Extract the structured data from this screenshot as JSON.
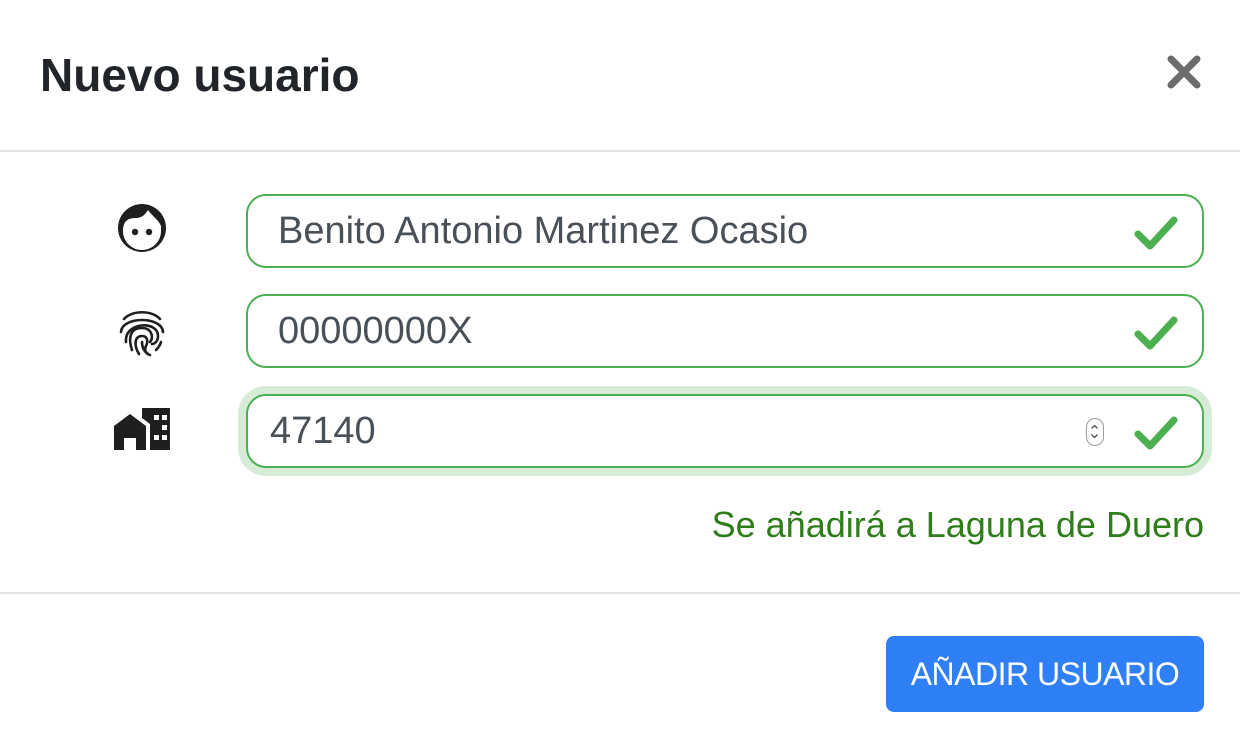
{
  "dialog": {
    "title": "Nuevo usuario",
    "close_icon": "close-icon"
  },
  "form": {
    "name": {
      "icon": "face-icon",
      "value": "Benito Antonio Martinez Ocasio",
      "status": "valid"
    },
    "id_number": {
      "icon": "fingerprint-icon",
      "value": "00000000X",
      "status": "valid"
    },
    "postal_code": {
      "icon": "home-city-icon",
      "value": "47140",
      "status": "valid",
      "focused": true
    },
    "hint": "Se añadirá a Laguna de Duero"
  },
  "footer": {
    "submit_label": "AÑADIR USUARIO"
  },
  "colors": {
    "valid": "#4caf50",
    "hint": "#2e7d1a",
    "primary": "#2f80f6",
    "title": "#212529"
  }
}
